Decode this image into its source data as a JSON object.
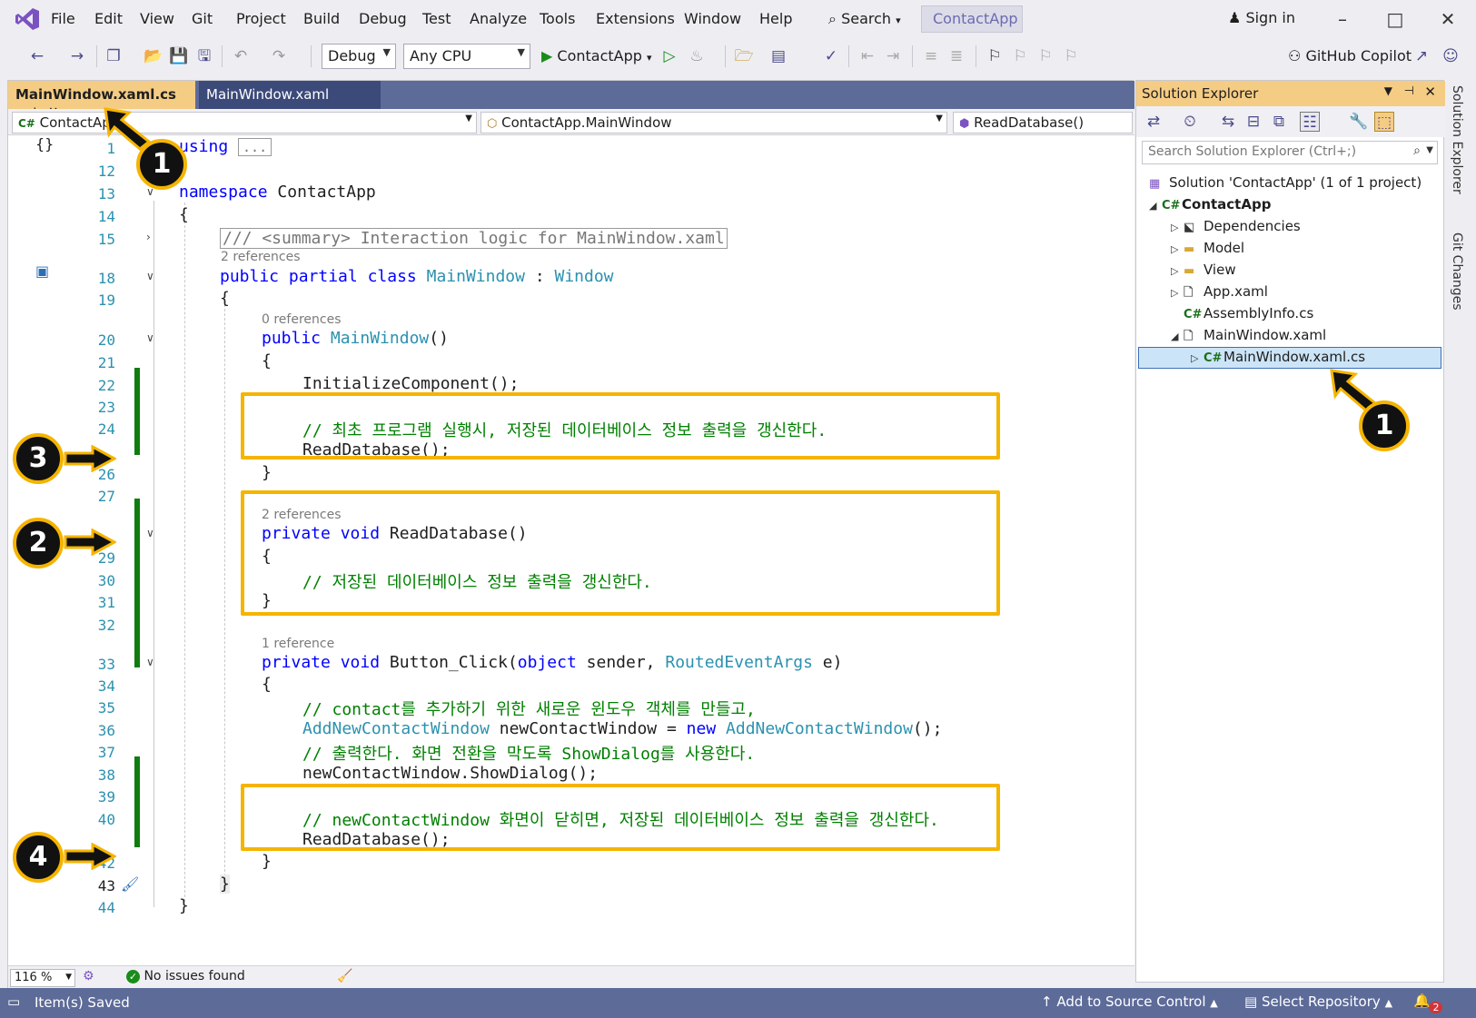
{
  "menu": [
    "File",
    "Edit",
    "View",
    "Git",
    "Project",
    "Build",
    "Debug",
    "Test",
    "Analyze",
    "Tools",
    "Extensions",
    "Window",
    "Help"
  ],
  "search_label": "Search",
  "solution_name": "ContactApp",
  "signin": "Sign in",
  "toolbar": {
    "config": "Debug",
    "platform": "Any CPU",
    "run_target": "ContactApp",
    "copilot": "GitHub Copilot"
  },
  "tabs": [
    "MainWindow.xaml.cs",
    "MainWindow.xaml"
  ],
  "navbar": {
    "project": "ContactApp",
    "type": "ContactApp.MainWindow",
    "member": "ReadDatabase()"
  },
  "lines": {
    "l1": "1",
    "l12": "12",
    "l13": "13",
    "l14": "14",
    "l15": "15",
    "l18": "18",
    "l19": "19",
    "l20": "20",
    "l21": "21",
    "l22": "22",
    "l23": "23",
    "l24": "24",
    "l26": "26",
    "l27": "27",
    "l29": "29",
    "l30": "30",
    "l31": "31",
    "l32": "32",
    "l33": "33",
    "l34": "34",
    "l35": "35",
    "l36": "36",
    "l37": "37",
    "l38": "38",
    "l39": "39",
    "l40": "40",
    "l42": "42",
    "l43": "43",
    "l44": "44"
  },
  "code": {
    "using_kw": "using",
    "using_collapsed": "...",
    "namespace_kw": "namespace",
    "namespace_name": "ContactApp",
    "open_brace": "{",
    "close_brace": "}",
    "summary": "/// <summary> Interaction logic for MainWindow.xaml",
    "refs_class": "2 references",
    "public_kw": "public",
    "partial_kw": "partial",
    "class_kw": "class",
    "class_name": "MainWindow",
    "colon": " : ",
    "base_class": "Window",
    "refs_ctor": "0 references",
    "ctor_name": "MainWindow",
    "ctor_parens": "()",
    "init_call": "InitializeComponent();",
    "comment_first_run": "// 최초 프로그램 실행시, 저장된 데이터베이스 정보 출력을 갱신한다.",
    "read_db_call": "ReadDatabase();",
    "refs_read": "2 references",
    "private_kw": "private",
    "void_kw": "void",
    "read_db_sig": "ReadDatabase()",
    "comment_update": "// 저장된 데이터베이스 정보 출력을 갱신한다.",
    "refs_click": "1 reference",
    "click_name": "Button_Click(",
    "object_kw": "object",
    "sender": " sender, ",
    "routed_type": "RoutedEventArgs",
    "e_param": " e)",
    "comment_contact": "// contact를 추가하기 위한 새로운 윈도우 객체를 만들고,",
    "new_window_type": "AddNewContactWindow",
    "new_window_var": " newContactWindow = ",
    "new_kw": "new",
    "new_window_ctor": "AddNewContactWindow",
    "new_window_tail": "();",
    "comment_print": "// 출력한다. 화면 전환을 막도록 ShowDialog를 사용한다.",
    "show_dialog": "newContactWindow.ShowDialog();",
    "comment_closed": "// newContactWindow 화면이 닫히면, 저장된 데이터베이스 정보 출력을 갱신한다."
  },
  "callouts": {
    "c1": "1",
    "c2": "2",
    "c3": "3",
    "c4": "4"
  },
  "editor_status": {
    "zoom": "116 %",
    "issues": "No issues found"
  },
  "solution_explorer": {
    "title": "Solution Explorer",
    "search_placeholder": "Search Solution Explorer (Ctrl+;)",
    "solution": "Solution 'ContactApp' (1 of 1 project)",
    "project": "ContactApp",
    "items": [
      "Dependencies",
      "Model",
      "View",
      "App.xaml",
      "AssemblyInfo.cs",
      "MainWindow.xaml",
      "MainWindow.xaml.cs"
    ]
  },
  "side_tabs": [
    "Solution Explorer",
    "Git Changes"
  ],
  "statusbar": {
    "left": "Item(s) Saved",
    "source_control": "Add to Source Control",
    "repo": "Select Repository",
    "notifications": "2"
  },
  "colors": {
    "accent": "#f5b400",
    "statusbar": "#5d6b99",
    "change_bar": "#107c10",
    "active_tab": "#f5cc84"
  }
}
